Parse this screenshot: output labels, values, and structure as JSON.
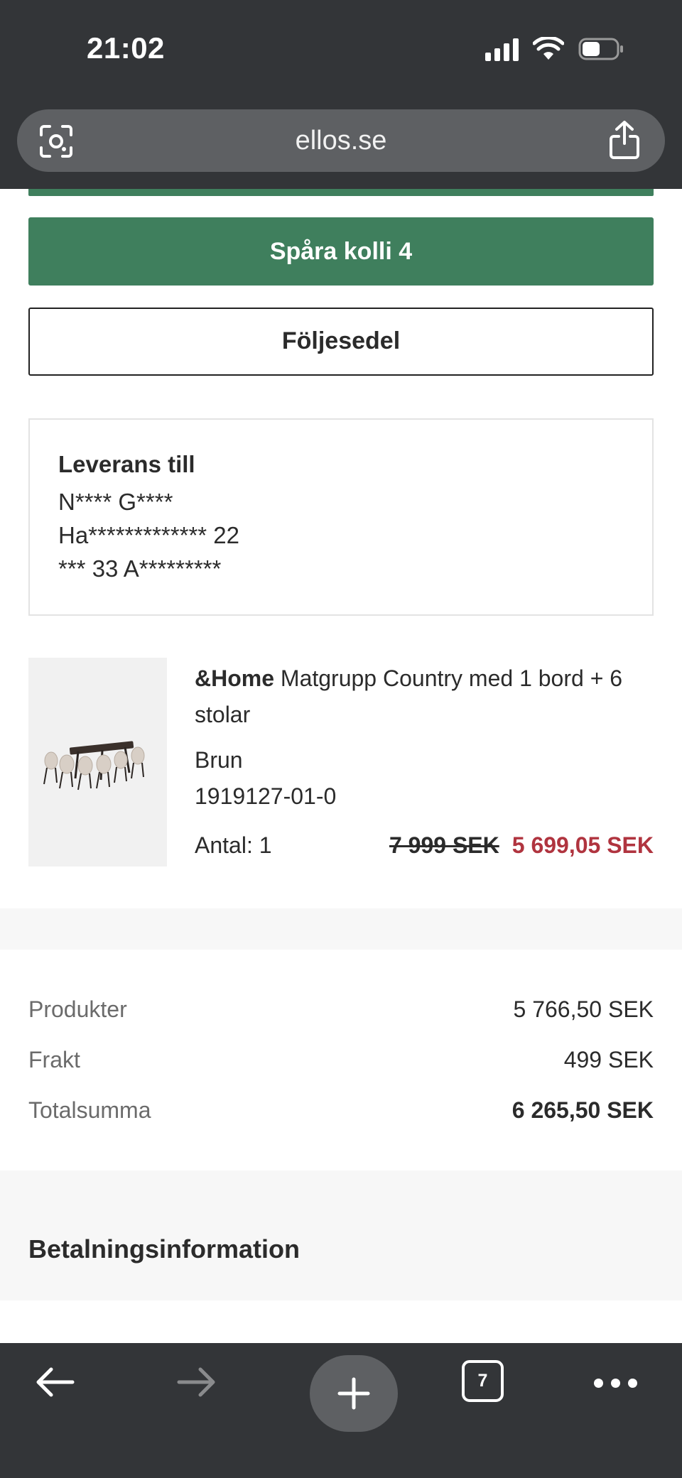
{
  "status_bar": {
    "time": "21:02",
    "icons": [
      "cellular-signal-icon",
      "wifi-icon",
      "battery-icon"
    ]
  },
  "browser": {
    "url": "ellos.se",
    "lens_icon": "camera-lens-icon",
    "share_icon": "share-icon",
    "toolbar": {
      "back_icon": "arrow-left-icon",
      "forward_icon": "arrow-right-icon",
      "new_tab_icon": "plus-icon",
      "tabs_count": "7",
      "more_icon": "ellipsis-icon"
    }
  },
  "order": {
    "track_button": "Spåra kolli 4",
    "packing_slip_button": "Följesedel",
    "delivery": {
      "title": "Leverans till",
      "lines": [
        "N**** G****",
        "Ha************* 22",
        "*** 33 A*********"
      ]
    },
    "product": {
      "brand": "&Home",
      "name": " Matgrupp Country med 1 bord + 6 stolar",
      "color": "Brun",
      "sku": "1919127-01-0",
      "quantity": "Antal: 1",
      "old_price": "7 999 SEK",
      "new_price": "5 699,05 SEK"
    },
    "summary": [
      {
        "label": "Produkter",
        "value": "5 766,50 SEK"
      },
      {
        "label": "Frakt",
        "value": "499 SEK"
      },
      {
        "label": "Totalsumma",
        "value": "6 265,50 SEK"
      }
    ],
    "payment_title": "Betalningsinformation"
  },
  "colors": {
    "accent_green": "#3f7f5d",
    "sale_red": "#b0343f",
    "browser_chrome": "#333538"
  }
}
